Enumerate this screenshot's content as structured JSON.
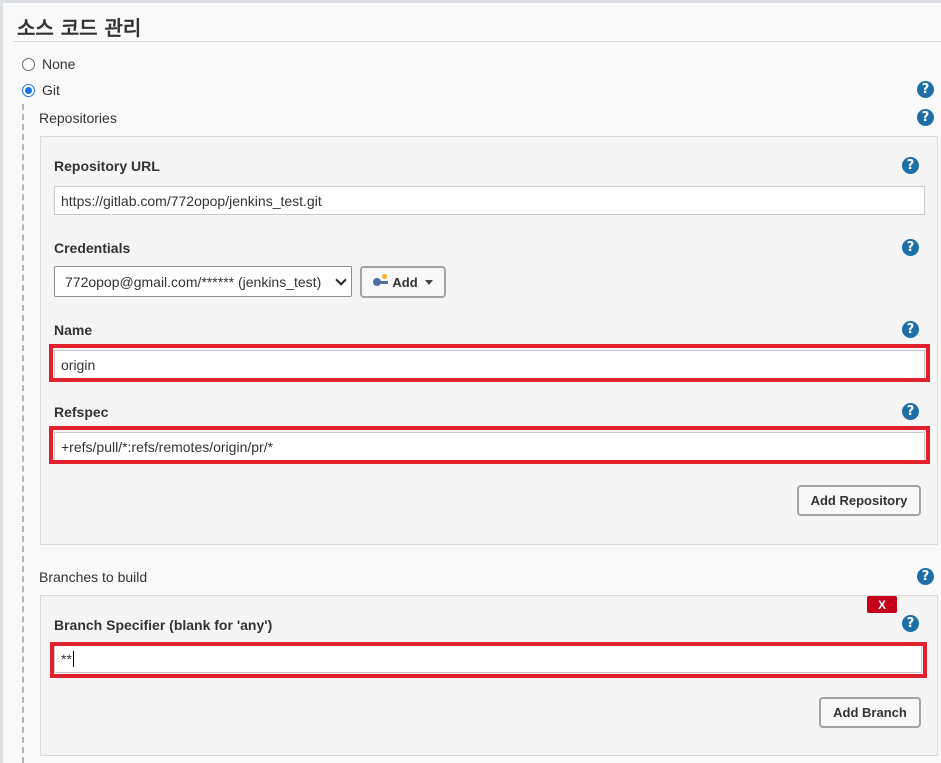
{
  "section": {
    "title": "소스 코드 관리"
  },
  "scm_options": [
    {
      "label": "None",
      "selected": false
    },
    {
      "label": "Git",
      "selected": true
    }
  ],
  "help_icon": {
    "glyph": "?",
    "color": "#1e6fa8"
  },
  "repositories": {
    "label": "Repositories",
    "repository_url": {
      "label": "Repository URL",
      "value": "https://gitlab.com/772opop/jenkins_test.git"
    },
    "credentials": {
      "label": "Credentials",
      "selected": "772opop@gmail.com/****** (jenkins_test)",
      "add_button": "Add"
    },
    "name": {
      "label": "Name",
      "value": "origin"
    },
    "refspec": {
      "label": "Refspec",
      "value": "+refs/pull/*:refs/remotes/origin/pr/*"
    },
    "add_repository_button": "Add Repository"
  },
  "branches": {
    "label": "Branches to build",
    "delete_button": "X",
    "branch_specifier": {
      "label": "Branch Specifier (blank for 'any')",
      "value": "**"
    },
    "add_branch_button": "Add Branch"
  },
  "colors": {
    "highlight": "#e0202c",
    "delete": "#c4001a",
    "radio_selected": "#1a73e8"
  }
}
